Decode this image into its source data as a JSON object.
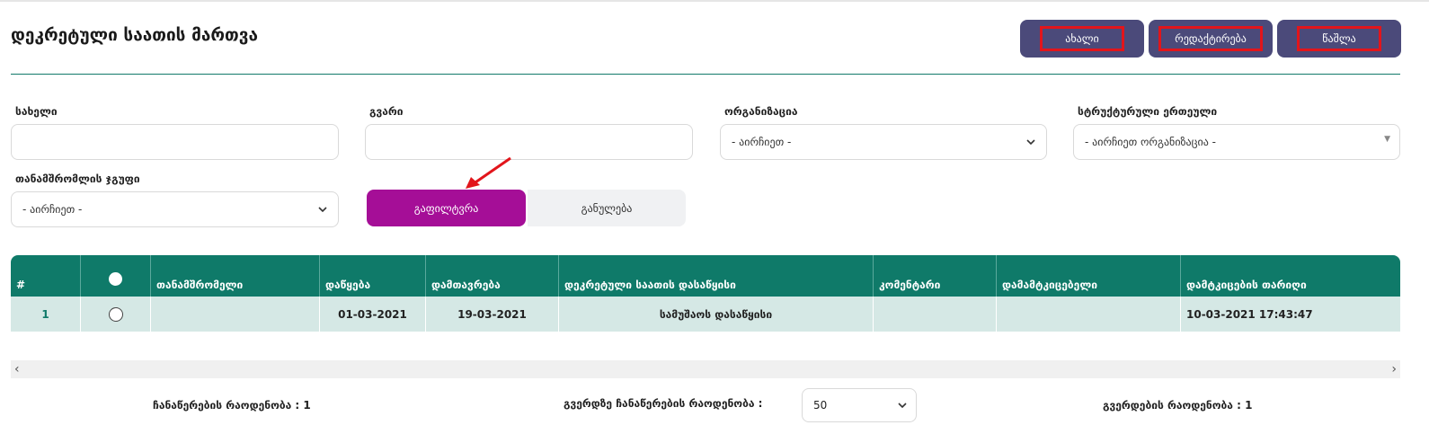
{
  "page": {
    "title": "დეკრეტული საათის მართვა"
  },
  "toolbar": {
    "new_label": "ახალი",
    "edit_label": "რედაქტირება",
    "delete_label": "წაშლა"
  },
  "filters": {
    "first_name_label": "სახელი",
    "last_name_label": "გვარი",
    "organization_label": "ორგანიზაცია",
    "organization_value": "- აირჩიეთ -",
    "unit_label": "სტრუქტურული ერთეული",
    "unit_value": "- აირჩიეთ ორგანიზაცია -",
    "group_label": "თანამშრომლის ჯგუფი",
    "group_value": "- აირჩიეთ -",
    "filter_label": "გაფილტვრა",
    "reset_label": "განულება"
  },
  "table": {
    "headers": [
      "#",
      "",
      "თანამშრომელი",
      "დაწყება",
      "დამთავრება",
      "დეკრეტული საათის დასაწყისი",
      "კომენტარი",
      "დამამტკიცებელი",
      "დამტკიცების თარიღი"
    ],
    "rows": [
      {
        "num": "1",
        "employee": "",
        "start": "01-03-2021",
        "end": "19-03-2021",
        "decree_start": "სამუშაოს დასაწყისი",
        "comment": "",
        "approver": "",
        "approval_date": "10-03-2021 17:43:47"
      }
    ]
  },
  "footer": {
    "records_count": "ჩანაწერების რაოდენობა : 1",
    "per_page_label": "გვერდზე ჩანაწერების რაოდენობა :",
    "per_page_value": "50",
    "pages_count": "გვერდების რაოდენობა : 1"
  },
  "colors": {
    "header_bg": "#0f7a69",
    "action_button": "#4b4a7a",
    "filter_button": "#a50e97",
    "highlight": "#e2151b",
    "row_bg": "#d5e8e5"
  },
  "icons": [
    "chevron-down-icon",
    "arrow-pointer",
    "scroll-left-icon",
    "scroll-right-icon",
    "radio-icon"
  ]
}
